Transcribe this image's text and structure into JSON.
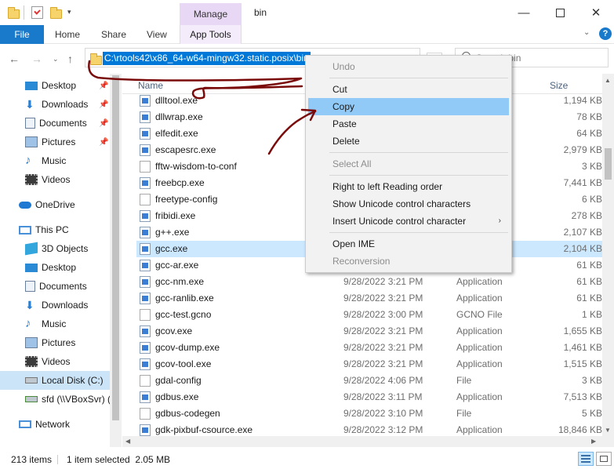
{
  "title_bar": {
    "context_tab_label": "Manage",
    "window_title": "bin"
  },
  "ribbon": {
    "tabs": [
      "File",
      "Home",
      "Share",
      "View"
    ],
    "context_tab": "App Tools"
  },
  "address_bar": {
    "path": "C:\\rtools42\\x86_64-w64-mingw32.static.posix\\bin",
    "search_placeholder": "Search bin"
  },
  "sidebar": {
    "quick_access": [
      {
        "label": "Desktop",
        "icon": "desktop-icon",
        "pinned": true
      },
      {
        "label": "Downloads",
        "icon": "downloads-icon",
        "pinned": true
      },
      {
        "label": "Documents",
        "icon": "documents-icon",
        "pinned": true
      },
      {
        "label": "Pictures",
        "icon": "pictures-icon",
        "pinned": true
      },
      {
        "label": "Music",
        "icon": "music-icon",
        "pinned": false
      },
      {
        "label": "Videos",
        "icon": "videos-icon",
        "pinned": false
      }
    ],
    "onedrive": "OneDrive",
    "this_pc": "This PC",
    "pc_items": [
      {
        "label": "3D Objects",
        "icon": "3d-objects-icon"
      },
      {
        "label": "Desktop",
        "icon": "desktop-icon"
      },
      {
        "label": "Documents",
        "icon": "documents-icon"
      },
      {
        "label": "Downloads",
        "icon": "downloads-icon"
      },
      {
        "label": "Music",
        "icon": "music-icon"
      },
      {
        "label": "Pictures",
        "icon": "pictures-icon"
      },
      {
        "label": "Videos",
        "icon": "videos-icon"
      },
      {
        "label": "Local Disk (C:)",
        "icon": "drive-icon"
      },
      {
        "label": "sfd (\\\\VBoxSvr) (",
        "icon": "network-drive-icon"
      }
    ],
    "network": "Network"
  },
  "file_list": {
    "columns": {
      "name": "Name",
      "size": "Size"
    },
    "rows": [
      {
        "name": "dlltool.exe",
        "date": "",
        "type": "",
        "size": "1,194 KB",
        "icon": "exe"
      },
      {
        "name": "dllwrap.exe",
        "date": "",
        "type": "",
        "size": "78 KB",
        "icon": "exe"
      },
      {
        "name": "elfedit.exe",
        "date": "",
        "type": "",
        "size": "64 KB",
        "icon": "exe"
      },
      {
        "name": "escapesrc.exe",
        "date": "",
        "type": "",
        "size": "2,979 KB",
        "icon": "exe"
      },
      {
        "name": "fftw-wisdom-to-conf",
        "date": "",
        "type": "",
        "size": "3 KB",
        "icon": "doc"
      },
      {
        "name": "freebcp.exe",
        "date": "",
        "type": "",
        "size": "7,441 KB",
        "icon": "exe"
      },
      {
        "name": "freetype-config",
        "date": "",
        "type": "",
        "size": "6 KB",
        "icon": "doc"
      },
      {
        "name": "fribidi.exe",
        "date": "",
        "type": "",
        "size": "278 KB",
        "icon": "exe"
      },
      {
        "name": "g++.exe",
        "date": "",
        "type": "",
        "size": "2,107 KB",
        "icon": "exe"
      },
      {
        "name": "gcc.exe",
        "date": "",
        "type": "",
        "size": "2,104 KB",
        "icon": "exe"
      },
      {
        "name": "gcc-ar.exe",
        "date": "",
        "type": "",
        "size": "61 KB",
        "icon": "exe"
      },
      {
        "name": "gcc-nm.exe",
        "date": "9/28/2022 3:21 PM",
        "type": "Application",
        "size": "61 KB",
        "icon": "exe"
      },
      {
        "name": "gcc-ranlib.exe",
        "date": "9/28/2022 3:21 PM",
        "type": "Application",
        "size": "61 KB",
        "icon": "exe"
      },
      {
        "name": "gcc-test.gcno",
        "date": "9/28/2022 3:00 PM",
        "type": "GCNO File",
        "size": "1 KB",
        "icon": "doc"
      },
      {
        "name": "gcov.exe",
        "date": "9/28/2022 3:21 PM",
        "type": "Application",
        "size": "1,655 KB",
        "icon": "exe"
      },
      {
        "name": "gcov-dump.exe",
        "date": "9/28/2022 3:21 PM",
        "type": "Application",
        "size": "1,461 KB",
        "icon": "exe"
      },
      {
        "name": "gcov-tool.exe",
        "date": "9/28/2022 3:21 PM",
        "type": "Application",
        "size": "1,515 KB",
        "icon": "exe"
      },
      {
        "name": "gdal-config",
        "date": "9/28/2022 4:06 PM",
        "type": "File",
        "size": "3 KB",
        "icon": "doc"
      },
      {
        "name": "gdbus.exe",
        "date": "9/28/2022 3:11 PM",
        "type": "Application",
        "size": "7,513 KB",
        "icon": "exe"
      },
      {
        "name": "gdbus-codegen",
        "date": "9/28/2022 3:10 PM",
        "type": "File",
        "size": "5 KB",
        "icon": "doc"
      },
      {
        "name": "gdk-pixbuf-csource.exe",
        "date": "9/28/2022 3:12 PM",
        "type": "Application",
        "size": "18,846 KB",
        "icon": "exe"
      }
    ],
    "selected_index": 9
  },
  "status_bar": {
    "item_count": "213 items",
    "selection": "1 item selected  2.05 MB"
  },
  "context_menu": {
    "items": [
      {
        "label": "Undo",
        "enabled": false
      },
      {
        "sep": true
      },
      {
        "label": "Cut",
        "enabled": true
      },
      {
        "label": "Copy",
        "enabled": true,
        "highlighted": true
      },
      {
        "label": "Paste",
        "enabled": true
      },
      {
        "label": "Delete",
        "enabled": true
      },
      {
        "sep": true
      },
      {
        "label": "Select All",
        "enabled": false
      },
      {
        "sep": true
      },
      {
        "label": "Right to left Reading order",
        "enabled": true
      },
      {
        "label": "Show Unicode control characters",
        "enabled": true
      },
      {
        "label": "Insert Unicode control character",
        "enabled": true,
        "submenu": true
      },
      {
        "sep": true
      },
      {
        "label": "Open IME",
        "enabled": true
      },
      {
        "label": "Reconversion",
        "enabled": false
      }
    ]
  },
  "colors": {
    "accent": "#1979ca",
    "selection": "#0078d7",
    "menu_highlight": "#91c9f7",
    "annotation_ink": "#7a0a0a"
  }
}
